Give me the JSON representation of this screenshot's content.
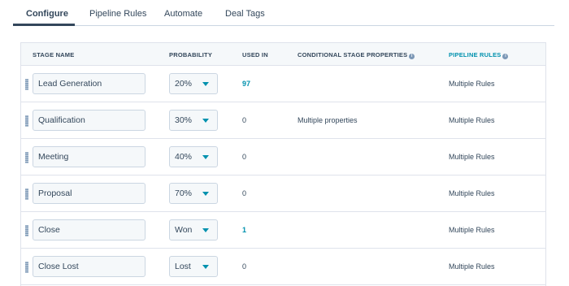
{
  "tabs": [
    {
      "label": "Configure",
      "active": true
    },
    {
      "label": "Pipeline Rules",
      "active": false
    },
    {
      "label": "Automate",
      "active": false
    },
    {
      "label": "Deal Tags",
      "active": false
    }
  ],
  "table": {
    "headers": {
      "stage_name": "STAGE NAME",
      "probability": "PROBABILITY",
      "used_in": "USED IN",
      "conditional": "CONDITIONAL STAGE PROPERTIES",
      "pipeline_rules": "PIPELINE RULES"
    },
    "info_glyph": "i",
    "rows": [
      {
        "stage": "Lead Generation",
        "probability": "20%",
        "used_in": "97",
        "conditional": "",
        "rules": "Multiple Rules"
      },
      {
        "stage": "Qualification",
        "probability": "30%",
        "used_in": "0",
        "conditional": "Multiple properties",
        "rules": "Multiple Rules"
      },
      {
        "stage": "Meeting",
        "probability": "40%",
        "used_in": "0",
        "conditional": "",
        "rules": "Multiple Rules"
      },
      {
        "stage": "Proposal",
        "probability": "70%",
        "used_in": "0",
        "conditional": "",
        "rules": "Multiple Rules"
      },
      {
        "stage": "Close",
        "probability": "Won",
        "used_in": "1",
        "conditional": "",
        "rules": "Multiple Rules"
      },
      {
        "stage": "Close Lost",
        "probability": "Lost",
        "used_in": "0",
        "conditional": "",
        "rules": "Multiple Rules"
      }
    ]
  },
  "colors": {
    "accent": "#0091ae",
    "text": "#33475b",
    "header_bg": "#f5f8fa",
    "border": "#dfe3eb"
  },
  "icons": {
    "drag": "drag-handle-icon",
    "caret": "caret-down-icon",
    "info": "info-icon"
  }
}
